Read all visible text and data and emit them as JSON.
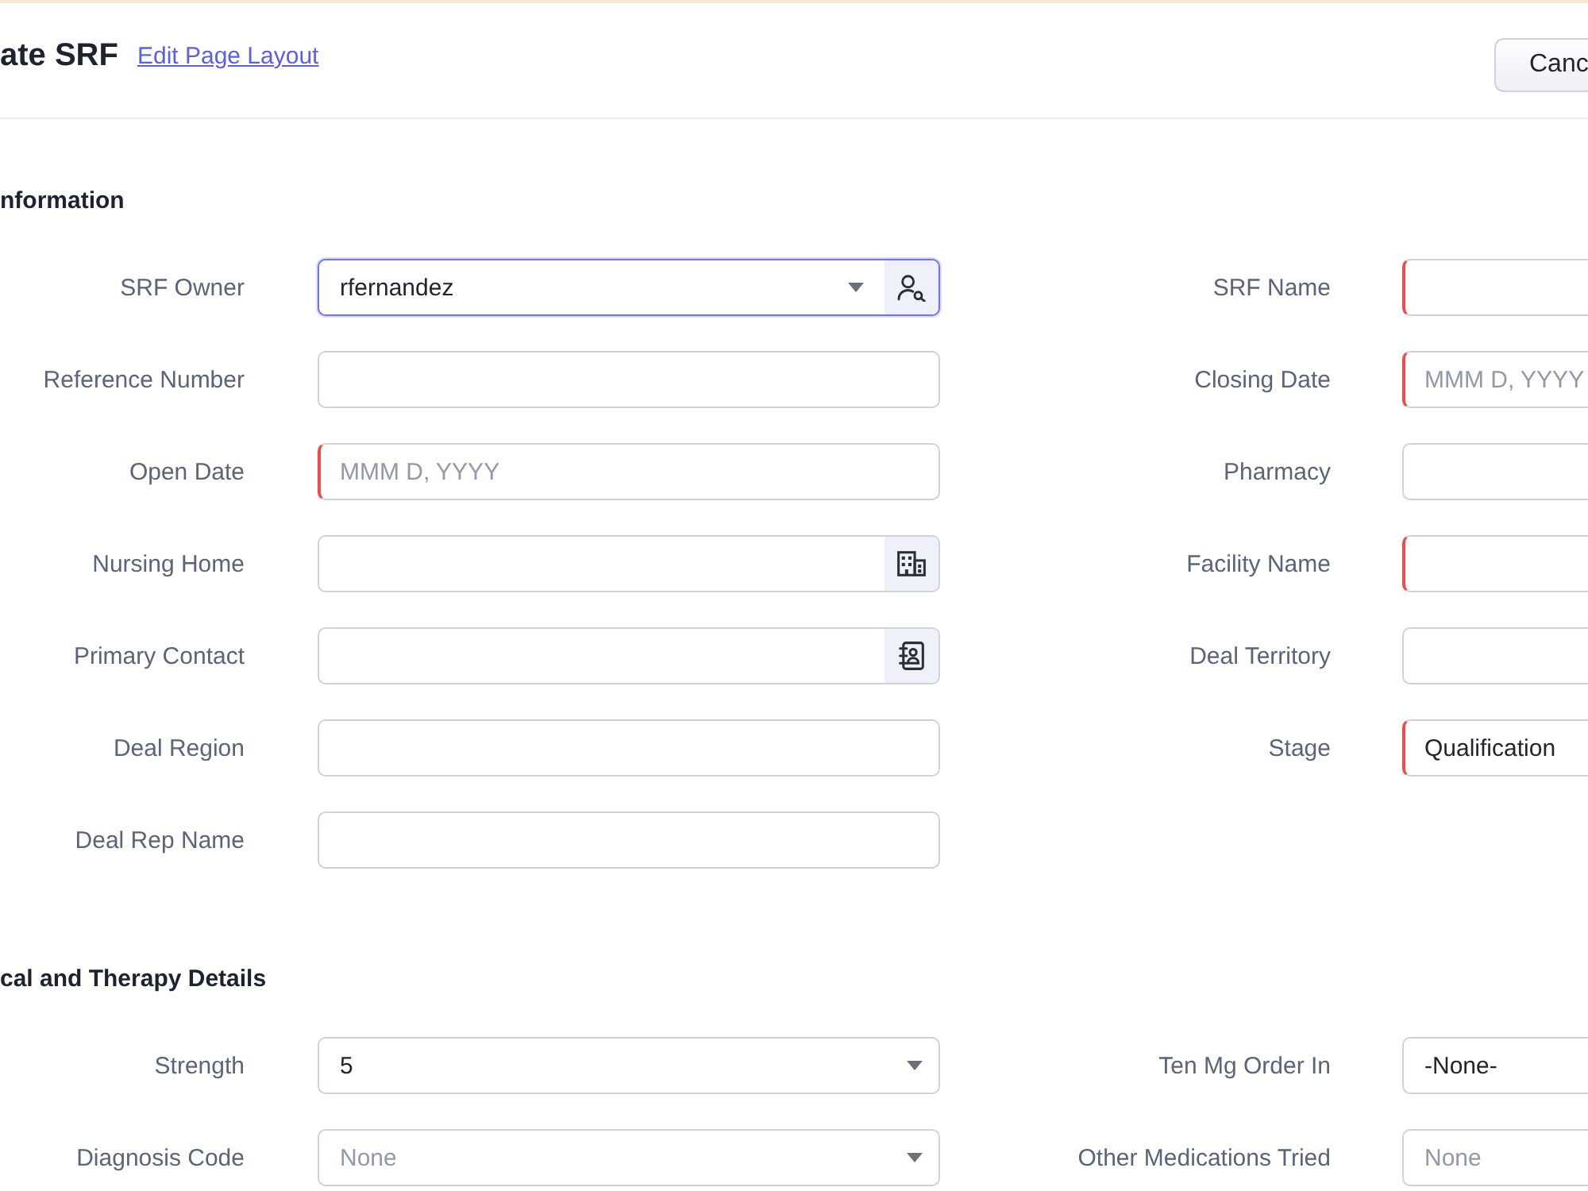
{
  "header": {
    "title": "ate SRF",
    "link": "Edit Page Layout",
    "buttons": [
      {
        "label": "Canc"
      }
    ]
  },
  "sections": [
    {
      "title": "nformation",
      "left_fields": [
        {
          "label": "SRF Owner",
          "kind": "owner",
          "value": "rfernandez",
          "required": false,
          "focused": true
        },
        {
          "label": "Reference Number",
          "kind": "text",
          "required": false,
          "focused": false
        },
        {
          "label": "Open Date",
          "kind": "text",
          "placeholder": "MMM D, YYYY",
          "required": true,
          "focused": false
        },
        {
          "label": "Nursing Home",
          "kind": "account",
          "required": false,
          "focused": false
        },
        {
          "label": "Primary Contact",
          "kind": "contact",
          "required": false,
          "focused": false
        },
        {
          "label": "Deal Region",
          "kind": "text",
          "required": false,
          "focused": false
        },
        {
          "label": "Deal Rep Name",
          "kind": "text",
          "required": false,
          "focused": false
        }
      ],
      "right_fields": [
        {
          "label": "SRF Name",
          "kind": "text",
          "required": true,
          "focused": false
        },
        {
          "label": "Closing Date",
          "kind": "text",
          "placeholder": "MMM D, YYYY",
          "required": true,
          "focused": false
        },
        {
          "label": "Pharmacy",
          "kind": "text",
          "required": false,
          "focused": false
        },
        {
          "label": "Facility Name",
          "kind": "text",
          "required": true,
          "focused": false
        },
        {
          "label": "Deal Territory",
          "kind": "text",
          "required": false,
          "focused": false
        },
        {
          "label": "Stage",
          "kind": "text",
          "value": "Qualification",
          "required": true,
          "focused": false
        }
      ]
    },
    {
      "title": "cal and Therapy Details",
      "left_fields": [
        {
          "label": "Strength",
          "kind": "select",
          "value": "5",
          "required": false,
          "focused": false
        },
        {
          "label": "Diagnosis Code",
          "kind": "select",
          "placeholder": "None",
          "required": false,
          "focused": false
        }
      ],
      "right_fields": [
        {
          "label": "Ten Mg Order In",
          "kind": "text",
          "value": "-None-",
          "required": false,
          "focused": false
        },
        {
          "label": "Other Medications Tried",
          "kind": "text",
          "placeholder": "None",
          "required": false,
          "focused": false
        }
      ]
    }
  ]
}
